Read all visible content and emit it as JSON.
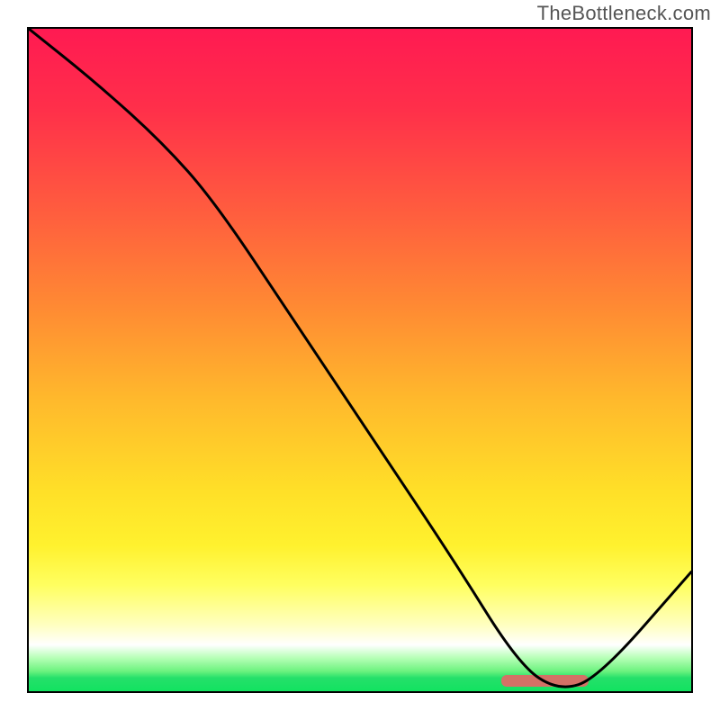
{
  "watermark": "TheBottleneck.com",
  "chart_data": {
    "type": "line",
    "title": "",
    "xlabel": "",
    "ylabel": "",
    "xlim": [
      0,
      100
    ],
    "ylim": [
      0,
      100
    ],
    "marker": {
      "x_start": 71,
      "x_end": 84
    },
    "series": [
      {
        "name": "curve",
        "x": [
          0,
          10,
          20,
          28,
          40,
          52,
          64,
          74,
          80,
          86,
          100
        ],
        "y": [
          100,
          92,
          83,
          74,
          56,
          38,
          20,
          4,
          0,
          2,
          18
        ]
      }
    ],
    "gradient_stops": [
      {
        "pos": 0,
        "color": "#ff1a52"
      },
      {
        "pos": 28,
        "color": "#ff5e3e"
      },
      {
        "pos": 56,
        "color": "#ffb92c"
      },
      {
        "pos": 78,
        "color": "#fff12e"
      },
      {
        "pos": 93,
        "color": "#ffffff"
      },
      {
        "pos": 100,
        "color": "#12e260"
      }
    ]
  }
}
